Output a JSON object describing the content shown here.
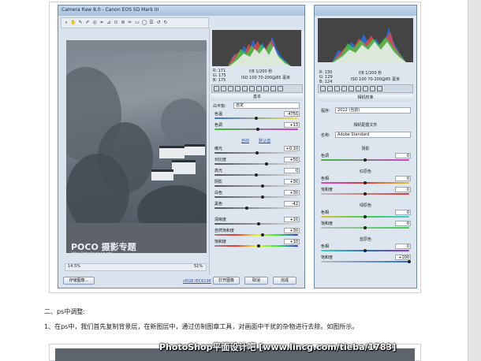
{
  "camera_raw": {
    "title": "Camera Raw 8.0 - Canon EOS 5D Mark III",
    "rgb": {
      "r": "R:  171",
      "g": "G:  175",
      "b": "B:  175"
    },
    "exif_top": "f/8  1/200 秒",
    "exif_bottom": "ISO 100  70-200@85 毫米",
    "panel_title": "基本",
    "white_balance": {
      "label": "白平衡:",
      "value": "自定"
    },
    "sliders_a": [
      {
        "label": "色温",
        "value": "4750"
      },
      {
        "label": "色调",
        "value": "+13"
      }
    ],
    "auto_label": "自动",
    "default_label": "默认值",
    "sliders_b": [
      {
        "label": "曝光",
        "value": "+0.10"
      },
      {
        "label": "对比度",
        "value": "+50"
      },
      {
        "label": "高光",
        "value": "0"
      },
      {
        "label": "阴影",
        "value": "+30"
      },
      {
        "label": "白色",
        "value": "+30"
      },
      {
        "label": "黑色",
        "value": "-42"
      }
    ],
    "sliders_c": [
      {
        "label": "清晰度",
        "value": "+10"
      },
      {
        "label": "自然饱和度",
        "value": "+30"
      },
      {
        "label": "饱和度",
        "value": "+10"
      }
    ],
    "watermark": "POCO 摄影专题",
    "watermark_url": "http://photo.poco.cn/",
    "zoom": "14.5%",
    "zoom_pct": "51%",
    "buttons": {
      "save": "存储图像...",
      "workflow": "sRGB IEC6196",
      "open": "打开图像",
      "cancel": "取消",
      "done": "完成"
    }
  },
  "camera_raw_2": {
    "rgb": {
      "r": "R:  130",
      "g": "G:  129",
      "b": "B:  124"
    },
    "exif_top": "f/8  1/200 秒",
    "exif_bottom": "ISO 100  70-200@85 毫米",
    "panel_title": "相机校准",
    "process": {
      "label": "程序:",
      "value": "2012 (当前)"
    },
    "profile_head": "相机配置文件",
    "profile": {
      "label": "名称:",
      "value": "Adobe Standard"
    },
    "sections": [
      {
        "title": "阴影",
        "rows": [
          {
            "label": "色调",
            "value": "0"
          }
        ]
      },
      {
        "title": "红原色",
        "rows": [
          {
            "label": "色相",
            "value": "0"
          },
          {
            "label": "饱和度",
            "value": "0"
          }
        ]
      },
      {
        "title": "绿原色",
        "rows": [
          {
            "label": "色相",
            "value": "0"
          },
          {
            "label": "饱和度",
            "value": "0"
          }
        ]
      },
      {
        "title": "蓝原色",
        "rows": [
          {
            "label": "色相",
            "value": "0"
          },
          {
            "label": "饱和度",
            "value": "+100"
          }
        ]
      }
    ]
  },
  "article": {
    "heading": "二、ps中调整:",
    "step1": "1、在ps中，我们首先复制背景层，在新图层中，通过仿制图章工具，对画面中干扰的杂物进行去除。如图所示。",
    "watermark": "PhotoShop平面设计吧 [www.lincg.com/tieba/1783]"
  }
}
